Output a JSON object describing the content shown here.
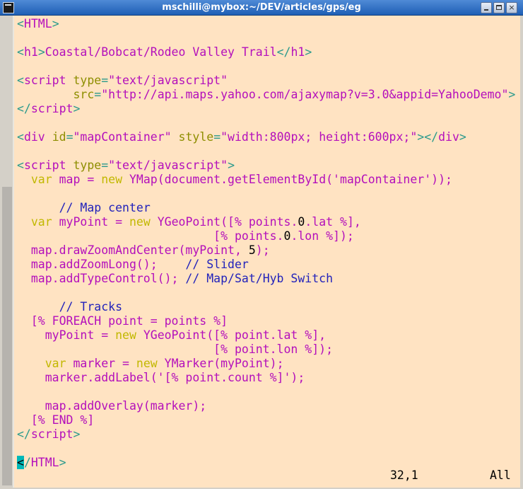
{
  "window": {
    "title": "mschilli@mybox:~/DEV/articles/gps/eg",
    "buttons": {
      "minimize": "minimize-icon",
      "maximize": "maximize-icon",
      "close": "×"
    }
  },
  "editor": {
    "lines": [
      [
        {
          "t": "<",
          "c": "tag"
        },
        {
          "t": "HTML",
          "c": "tn"
        },
        {
          "t": ">",
          "c": "tag"
        }
      ],
      [],
      [
        {
          "t": "<",
          "c": "tag"
        },
        {
          "t": "h1",
          "c": "tn"
        },
        {
          "t": ">",
          "c": "tag"
        },
        {
          "t": "Coastal/Bobcat/Rodeo Valley Trail",
          "c": "pl"
        },
        {
          "t": "</",
          "c": "tag"
        },
        {
          "t": "h1",
          "c": "tn"
        },
        {
          "t": ">",
          "c": "tag"
        }
      ],
      [],
      [
        {
          "t": "<",
          "c": "tag"
        },
        {
          "t": "script",
          "c": "tn"
        },
        {
          "t": " "
        },
        {
          "t": "type",
          "c": "attr"
        },
        {
          "t": "=",
          "c": "tag"
        },
        {
          "t": "\"text/javascript\"",
          "c": "str"
        }
      ],
      [
        {
          "t": "        "
        },
        {
          "t": "src",
          "c": "attr"
        },
        {
          "t": "=",
          "c": "tag"
        },
        {
          "t": "\"http://api.maps.yahoo.com/ajaxymap?v=3.0&appid=YahooDemo\"",
          "c": "str"
        },
        {
          "t": ">",
          "c": "tag"
        }
      ],
      [
        {
          "t": "</",
          "c": "tag"
        },
        {
          "t": "script",
          "c": "tn"
        },
        {
          "t": ">",
          "c": "tag"
        }
      ],
      [],
      [
        {
          "t": "<",
          "c": "tag"
        },
        {
          "t": "div",
          "c": "tn"
        },
        {
          "t": " "
        },
        {
          "t": "id",
          "c": "attr"
        },
        {
          "t": "=",
          "c": "tag"
        },
        {
          "t": "\"mapContainer\"",
          "c": "str"
        },
        {
          "t": " "
        },
        {
          "t": "style",
          "c": "attr"
        },
        {
          "t": "=",
          "c": "tag"
        },
        {
          "t": "\"width:800px; height:600px;\"",
          "c": "str"
        },
        {
          "t": "></",
          "c": "tag"
        },
        {
          "t": "div",
          "c": "tn"
        },
        {
          "t": ">",
          "c": "tag"
        }
      ],
      [],
      [
        {
          "t": "<",
          "c": "tag"
        },
        {
          "t": "script",
          "c": "tn"
        },
        {
          "t": " "
        },
        {
          "t": "type",
          "c": "attr"
        },
        {
          "t": "=",
          "c": "tag"
        },
        {
          "t": "\"text/javascript\"",
          "c": "str"
        },
        {
          "t": ">",
          "c": "tag"
        }
      ],
      [
        {
          "t": "  "
        },
        {
          "t": "var",
          "c": "kw"
        },
        {
          "t": " map = ",
          "c": "pl"
        },
        {
          "t": "new",
          "c": "kw"
        },
        {
          "t": " YMap(document.getElementById('mapContainer'));",
          "c": "pl"
        }
      ],
      [],
      [
        {
          "t": "      "
        },
        {
          "t": "// Map center",
          "c": "cm"
        }
      ],
      [
        {
          "t": "  "
        },
        {
          "t": "var",
          "c": "kw"
        },
        {
          "t": " myPoint = ",
          "c": "pl"
        },
        {
          "t": "new",
          "c": "kw"
        },
        {
          "t": " YGeoPoint([% points.",
          "c": "pl"
        },
        {
          "t": "0",
          "c": "num"
        },
        {
          "t": ".lat %],",
          "c": "pl"
        }
      ],
      [
        {
          "t": "                            [% points.",
          "c": "pl"
        },
        {
          "t": "0",
          "c": "num"
        },
        {
          "t": ".lon %]);",
          "c": "pl"
        }
      ],
      [
        {
          "t": "  map.drawZoomAndCenter(myPoint, ",
          "c": "pl"
        },
        {
          "t": "5",
          "c": "num"
        },
        {
          "t": ");",
          "c": "pl"
        }
      ],
      [
        {
          "t": "  map.addZoomLong();    ",
          "c": "pl"
        },
        {
          "t": "// Slider",
          "c": "cm"
        }
      ],
      [
        {
          "t": "  map.addTypeControl(); ",
          "c": "pl"
        },
        {
          "t": "// Map/Sat/Hyb Switch",
          "c": "cm"
        }
      ],
      [],
      [
        {
          "t": "      "
        },
        {
          "t": "// Tracks",
          "c": "cm"
        }
      ],
      [
        {
          "t": "  [% FOREACH point = points %]",
          "c": "tt"
        }
      ],
      [
        {
          "t": "    myPoint = ",
          "c": "pl"
        },
        {
          "t": "new",
          "c": "kw"
        },
        {
          "t": " YGeoPoint([% point.lat %],",
          "c": "pl"
        }
      ],
      [
        {
          "t": "                            [% point.lon %]);",
          "c": "pl"
        }
      ],
      [
        {
          "t": "    "
        },
        {
          "t": "var",
          "c": "kw"
        },
        {
          "t": " marker = ",
          "c": "pl"
        },
        {
          "t": "new",
          "c": "kw"
        },
        {
          "t": " YMarker(myPoint);",
          "c": "pl"
        }
      ],
      [
        {
          "t": "    marker.addLabel('[% point.count %]');",
          "c": "pl"
        }
      ],
      [],
      [
        {
          "t": "    map.addOverlay(marker);",
          "c": "pl"
        }
      ],
      [
        {
          "t": "  [% END %]",
          "c": "tt"
        }
      ],
      [
        {
          "t": "</",
          "c": "tag"
        },
        {
          "t": "script",
          "c": "tn"
        },
        {
          "t": ">",
          "c": "tag"
        }
      ],
      [],
      [
        {
          "t": "<",
          "c": "cursor"
        },
        {
          "t": "/",
          "c": "tag"
        },
        {
          "t": "HTML",
          "c": "tn"
        },
        {
          "t": ">",
          "c": "tag"
        }
      ]
    ]
  },
  "status": {
    "position": "32,1",
    "scroll": "All"
  }
}
